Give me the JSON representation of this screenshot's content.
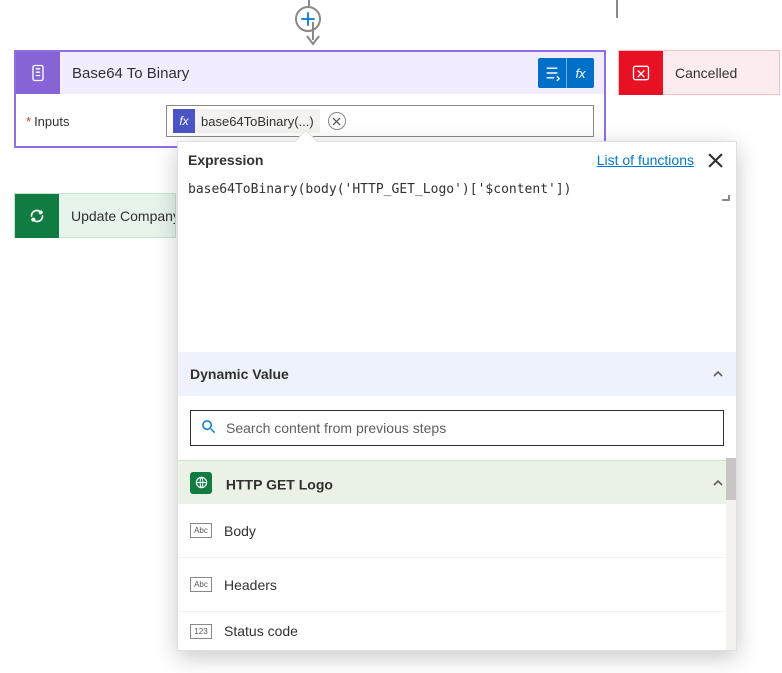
{
  "plus_button": {
    "name": "plus-add-step"
  },
  "cards": {
    "b64": {
      "title": "Base64 To Binary",
      "inputs_label": "Inputs",
      "token_label": "base64ToBinary(...)",
      "fx_glyph": "fx",
      "required_mark": "*"
    },
    "cancelled": {
      "title": "Cancelled"
    },
    "update": {
      "title": "Update Company"
    }
  },
  "expression_panel": {
    "title": "Expression",
    "list_functions": "List of functions",
    "code": "base64ToBinary(body('HTTP_GET_Logo')['$content'])",
    "dynamic_value_header": "Dynamic Value",
    "search_placeholder": "Search content from previous steps",
    "step_source_title": "HTTP GET Logo",
    "outputs": [
      {
        "type_badge": "Abc",
        "label": "Body"
      },
      {
        "type_badge": "Abc",
        "label": "Headers"
      },
      {
        "type_badge": "123",
        "label": "Status code"
      }
    ]
  }
}
